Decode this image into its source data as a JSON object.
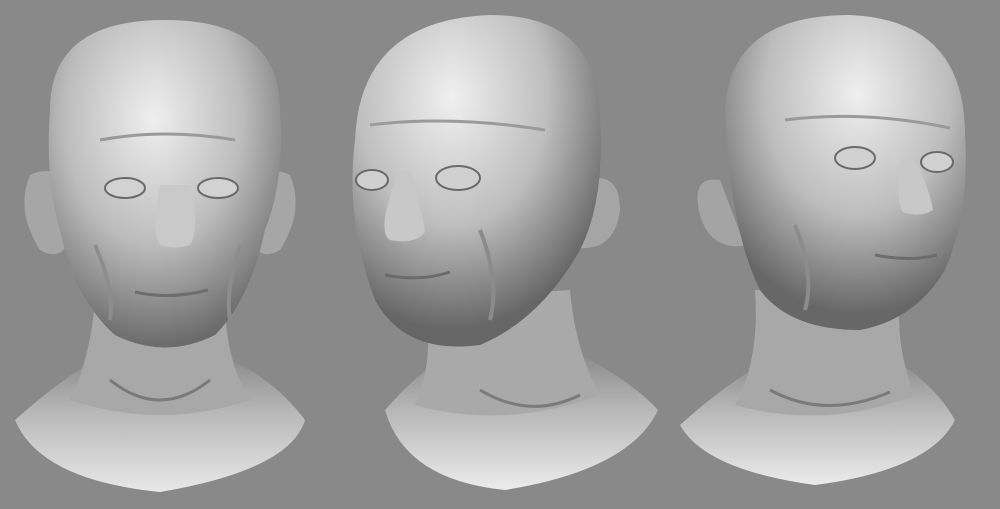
{
  "scene": {
    "background_color": "#898989",
    "clay_light": "#f2f2f2",
    "clay_mid": "#bdbdbd",
    "clay_dark": "#5e5e5e",
    "busts": [
      {
        "view": "front"
      },
      {
        "view": "three-quarter-left"
      },
      {
        "view": "three-quarter-right"
      }
    ]
  }
}
